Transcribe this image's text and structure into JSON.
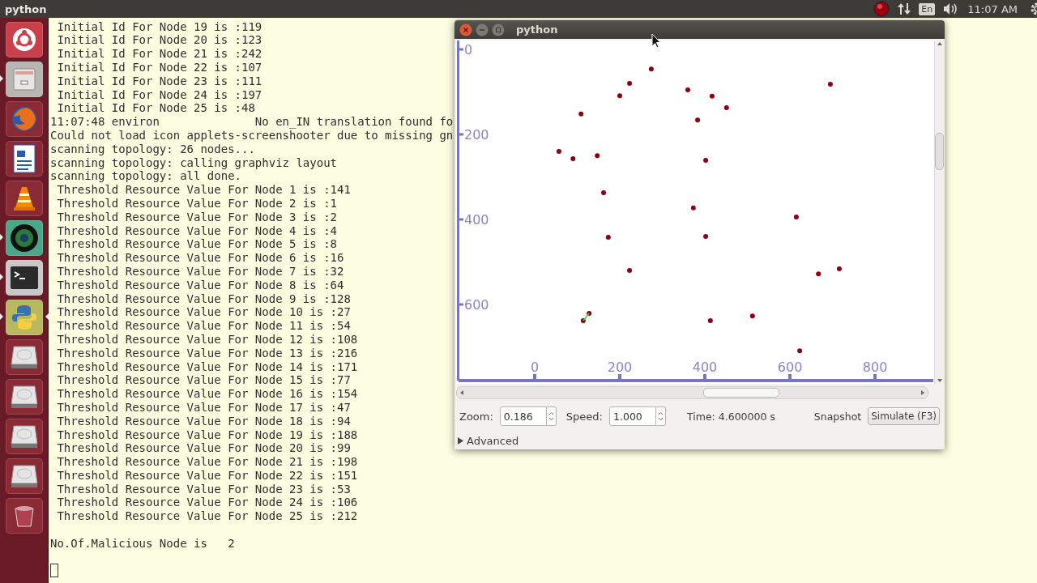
{
  "top_bar": {
    "app_title": "python",
    "keyboard": "En",
    "clock": "11:07 AM"
  },
  "launcher": [
    {
      "kind": "ubuntu",
      "running": false,
      "focused": false
    },
    {
      "kind": "files",
      "running": true,
      "focused": false
    },
    {
      "kind": "firefox",
      "running": false,
      "focused": false
    },
    {
      "kind": "writer",
      "running": false,
      "focused": false
    },
    {
      "kind": "vlc",
      "running": false,
      "focused": false
    },
    {
      "kind": "camera",
      "running": true,
      "focused": false
    },
    {
      "kind": "terminal",
      "running": true,
      "focused": false
    },
    {
      "kind": "python",
      "running": true,
      "focused": true
    },
    {
      "kind": "drive",
      "running": false,
      "focused": false
    },
    {
      "kind": "drive",
      "running": false,
      "focused": false
    },
    {
      "kind": "drive",
      "running": false,
      "focused": false
    },
    {
      "kind": "drive",
      "running": false,
      "focused": false
    },
    {
      "kind": "trash",
      "running": false,
      "focused": false
    }
  ],
  "terminal": {
    "lines": [
      " Initial Id For Node 19 is :119",
      " Initial Id For Node 20 is :123",
      " Initial Id For Node 21 is :242",
      " Initial Id For Node 22 is :107",
      " Initial Id For Node 23 is :111",
      " Initial Id For Node 24 is :197",
      " Initial Id For Node 25 is :48",
      "11:07:48 environ              No en_IN translation found fo",
      "Could not load icon applets-screenshooter due to missing gn",
      "scanning topology: 26 nodes...",
      "scanning topology: calling graphviz layout",
      "scanning topology: all done.",
      " Threshold Resource Value For Node 1 is :141",
      " Threshold Resource Value For Node 2 is :1",
      " Threshold Resource Value For Node 3 is :2",
      " Threshold Resource Value For Node 4 is :4",
      " Threshold Resource Value For Node 5 is :8",
      " Threshold Resource Value For Node 6 is :16",
      " Threshold Resource Value For Node 7 is :32",
      " Threshold Resource Value For Node 8 is :64",
      " Threshold Resource Value For Node 9 is :128",
      " Threshold Resource Value For Node 10 is :27",
      " Threshold Resource Value For Node 11 is :54",
      " Threshold Resource Value For Node 12 is :108",
      " Threshold Resource Value For Node 13 is :216",
      " Threshold Resource Value For Node 14 is :171",
      " Threshold Resource Value For Node 15 is :77",
      " Threshold Resource Value For Node 16 is :154",
      " Threshold Resource Value For Node 17 is :47",
      " Threshold Resource Value For Node 18 is :94",
      " Threshold Resource Value For Node 19 is :188",
      " Threshold Resource Value For Node 20 is :99",
      " Threshold Resource Value For Node 21 is :198",
      " Threshold Resource Value For Node 22 is :151",
      " Threshold Resource Value For Node 23 is :53",
      " Threshold Resource Value For Node 24 is :106",
      " Threshold Resource Value For Node 25 is :212"
    ],
    "summary": "No.Of.Malicious Node is   2",
    "cursor": true
  },
  "window": {
    "title": "python",
    "canvas": {
      "chart_data": {
        "type": "scatter",
        "xlim": [
          -179,
          937
        ],
        "ylim": [
          779,
          -21
        ],
        "xticks": [
          0,
          200,
          400,
          600,
          800
        ],
        "yticks": [
          0,
          200,
          400,
          600
        ],
        "series": [
          {
            "color": "#8b0012",
            "x": [
              274,
              223,
              200,
              360,
              417,
              451,
              695,
              109,
              383,
              57,
              90,
              147,
              402,
              162,
              373,
              615,
              173,
              402,
              223,
              667,
              716,
              128,
              114,
              413,
              512,
              623
            ],
            "values": [
              46,
              80,
              109,
              95,
              110,
              137,
              82,
              152,
              166,
              240,
              257,
              250,
              261,
              337,
              373,
              394,
              442,
              440,
              520,
              528,
              516,
              621,
              638,
              638,
              627,
              709
            ]
          },
          {
            "type": "line",
            "color": "#44cc44",
            "x": [
              128,
              114
            ],
            "values": [
              621,
              638
            ]
          }
        ]
      }
    },
    "zoom": {
      "label": "Zoom:",
      "value": "0.186"
    },
    "speed": {
      "label": "Speed:",
      "value": "1.000"
    },
    "time": "Time: 4.600000 s",
    "snapshot": "Snapshot",
    "simulate": "Simulate (F3)",
    "advanced": {
      "label": "Advanced",
      "expanded": false
    }
  }
}
